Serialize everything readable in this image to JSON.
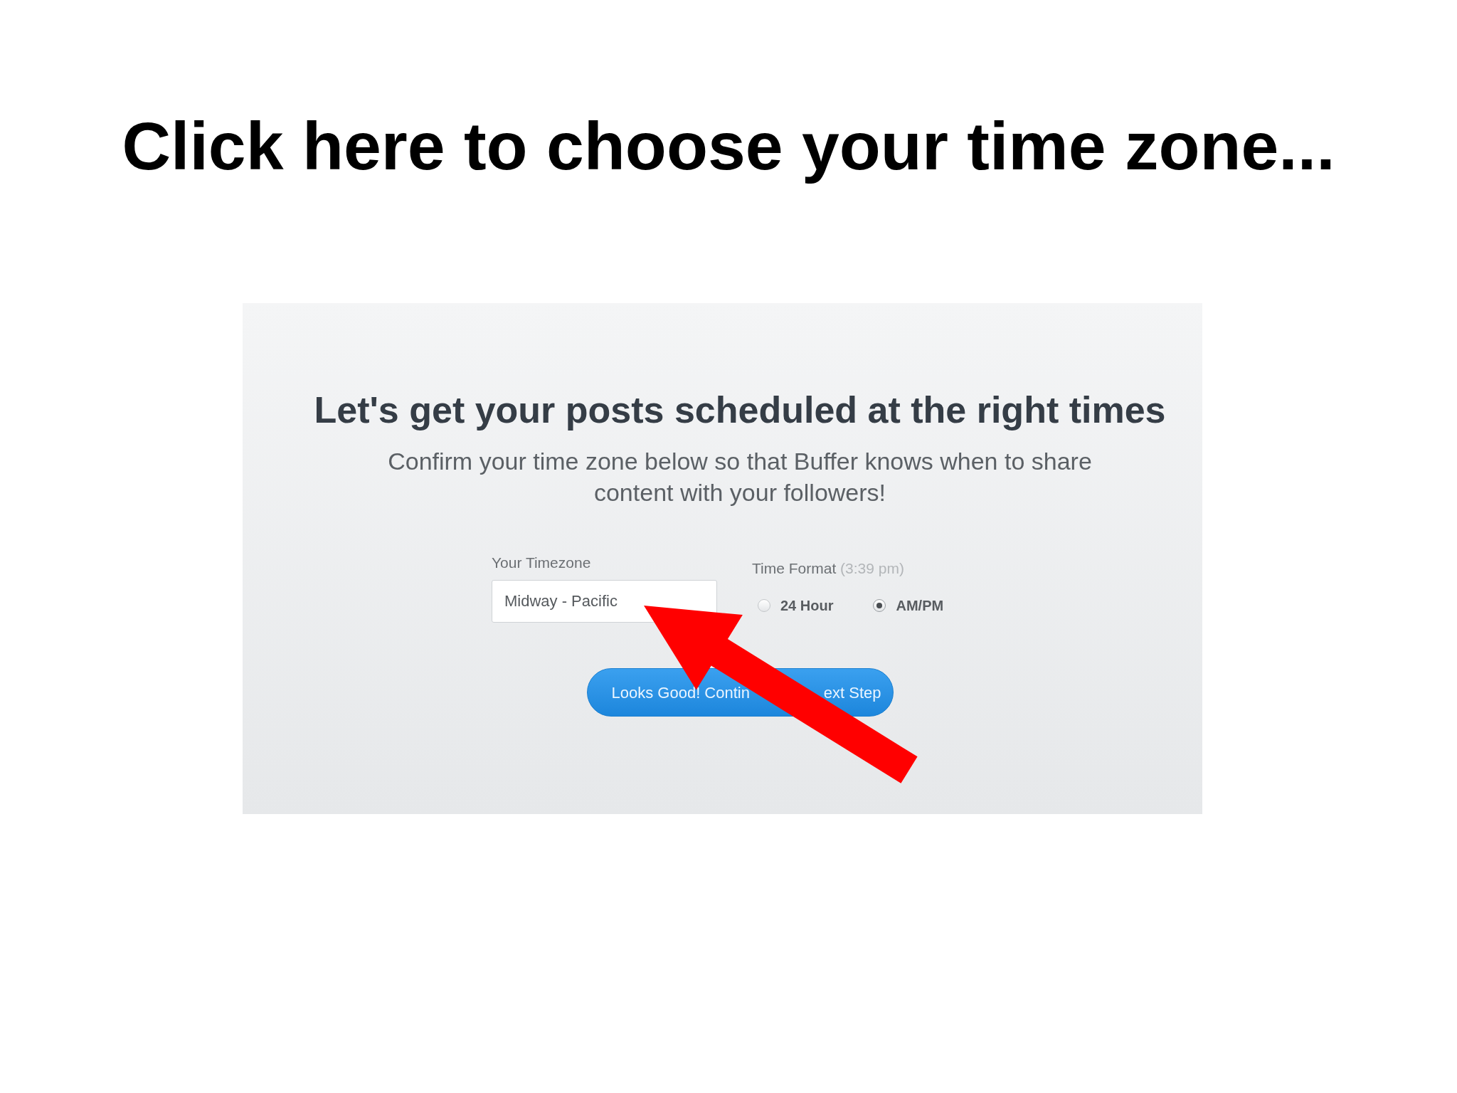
{
  "headline": "Click here to choose your time zone...",
  "screenshot": {
    "title": "Let's get your posts scheduled at the right times",
    "subtitle": "Confirm your time zone below so that Buffer knows when to share content with your followers!",
    "timezone": {
      "label": "Your Timezone",
      "value": "Midway - Pacific"
    },
    "time_format": {
      "label": "Time Format",
      "example": "(3:39 pm)",
      "options": [
        {
          "label": "24 Hour",
          "selected": false
        },
        {
          "label": "AM/PM",
          "selected": true
        }
      ]
    },
    "button": {
      "visible_text": [
        "Looks Good! Contin",
        "ext Step"
      ]
    }
  }
}
